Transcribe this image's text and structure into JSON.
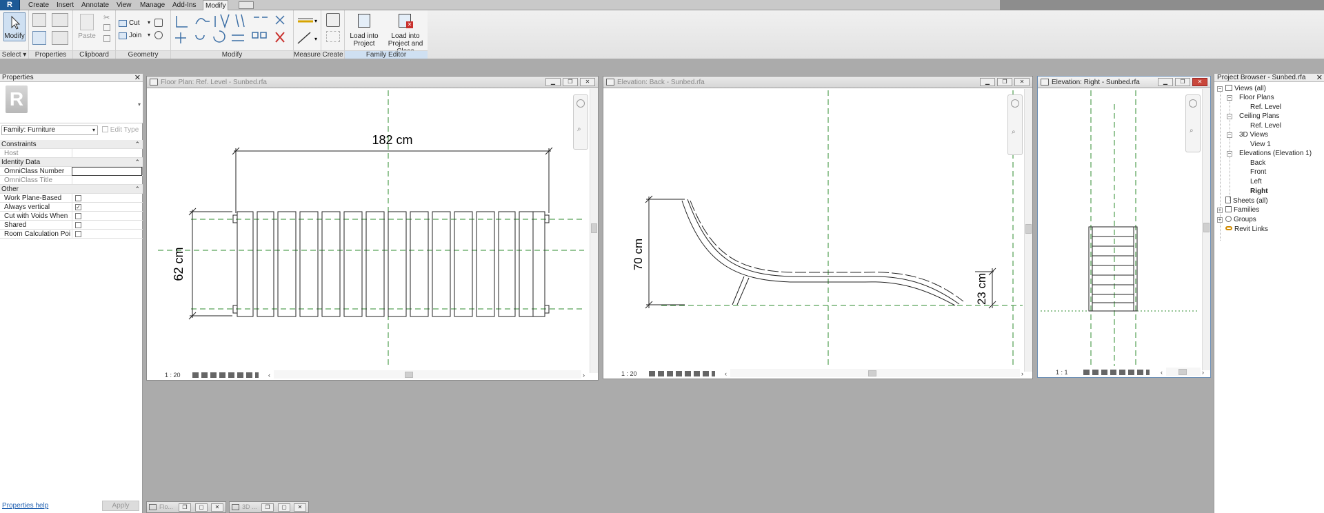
{
  "menu": {
    "app_button": "R",
    "tabs": [
      "Create",
      "Insert",
      "Annotate",
      "View",
      "Manage",
      "Add-Ins",
      "Modify"
    ]
  },
  "ribbon": {
    "panels": {
      "select": "Select",
      "properties": "Properties",
      "clipboard": "Clipboard",
      "geometry": "Geometry",
      "modify": "Modify",
      "measure": "Measure",
      "create": "Create",
      "family_editor": "Family Editor"
    },
    "modify_label": "Modify",
    "paste_label": "Paste",
    "cut_label": "Cut",
    "join_label": "Join",
    "load_into_project_1": "Load into",
    "load_into_project_2": "Project",
    "load_close_1": "Load into",
    "load_close_2": "Project and Close"
  },
  "properties": {
    "title": "Properties",
    "close": "✕",
    "logo": "R",
    "family": "Family: Furniture",
    "edit_type": "Edit Type",
    "sections": {
      "constraints": "Constraints",
      "identity": "Identity Data",
      "other": "Other"
    },
    "rows": {
      "host": "Host",
      "omniclass_number": "OmniClass Number",
      "omniclass_title": "OmniClass Title",
      "work_plane": "Work Plane-Based",
      "always_vertical": "Always vertical",
      "cut_voids": "Cut with Voids When ...",
      "shared": "Shared",
      "room_calc": "Room Calculation Point"
    },
    "always_vertical_checked": true,
    "help": "Properties help",
    "apply": "Apply"
  },
  "views": {
    "floor": {
      "title": "Floor Plan: Ref. Level - Sunbed.rfa",
      "scale": "1 : 20",
      "dim_length": "182 cm",
      "dim_width": "62 cm"
    },
    "back": {
      "title": "Elevation: Back - Sunbed.rfa",
      "scale": "1 : 20",
      "dim_height": "70 cm",
      "dim_small": "23 cm"
    },
    "right": {
      "title": "Elevation: Right - Sunbed.rfa",
      "scale": "1 : 1"
    }
  },
  "browser": {
    "title": "Project Browser - Sunbed.rfa",
    "close": "✕",
    "nodes": {
      "views_all": "Views (all)",
      "floor_plans": "Floor Plans",
      "ref_level_1": "Ref. Level",
      "ceiling_plans": "Ceiling Plans",
      "ref_level_2": "Ref. Level",
      "views_3d": "3D Views",
      "view_1": "View 1",
      "elevations": "Elevations (Elevation 1)",
      "back": "Back",
      "front": "Front",
      "left": "Left",
      "right": "Right",
      "sheets": "Sheets (all)",
      "families": "Families",
      "groups": "Groups",
      "revit_links": "Revit Links"
    }
  },
  "minimized": [
    "Flo...",
    "3D ..."
  ],
  "colors": {
    "accent": "#1d5a96",
    "refplane": "#2e8b2e",
    "close_red": "#c9473b"
  }
}
